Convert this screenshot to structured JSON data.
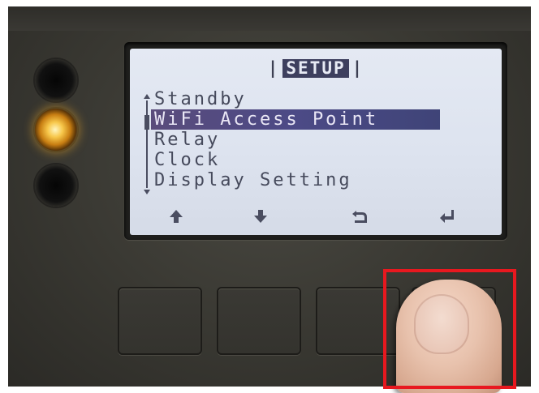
{
  "screen": {
    "title": "SETUP",
    "menu_items": [
      {
        "label": "Standby",
        "selected": false
      },
      {
        "label": "WiFi Access Point",
        "selected": true
      },
      {
        "label": "Relay",
        "selected": false
      },
      {
        "label": "Clock",
        "selected": false
      },
      {
        "label": "Display Setting",
        "selected": false
      }
    ],
    "softkeys": [
      {
        "icon": "arrow-up-icon"
      },
      {
        "icon": "arrow-down-icon"
      },
      {
        "icon": "back-icon"
      },
      {
        "icon": "enter-icon"
      }
    ]
  },
  "indicators": {
    "leds": [
      "off",
      "on",
      "off"
    ],
    "led_on_color": "#f5b533"
  },
  "colors": {
    "lcd_background": "#dde3ef",
    "lcd_text": "#4a4d60",
    "selection_bar": "#4c4a86",
    "highlight_box": "#e8181f"
  }
}
